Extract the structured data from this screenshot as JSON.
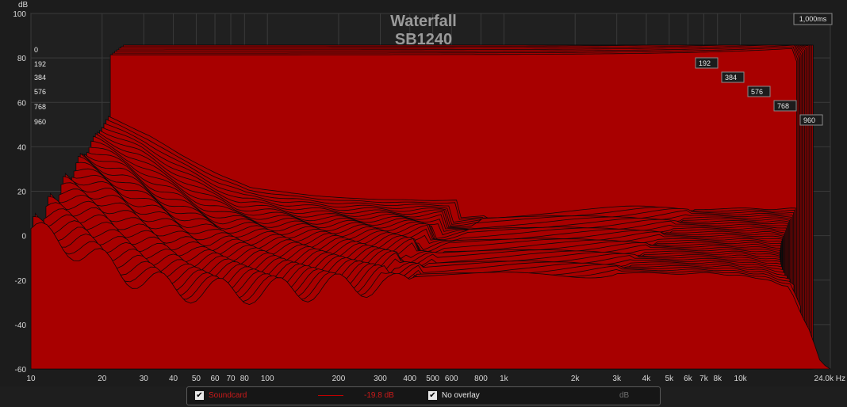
{
  "chart_data": {
    "type": "area",
    "title": "Waterfall",
    "subtitle": "SB1240",
    "ylabel": "dB",
    "xunit": "Hz",
    "x_scale": "log",
    "xlim": [
      10,
      24000
    ],
    "ylim": [
      -60,
      100
    ],
    "y_ticks": [
      "100",
      "80",
      "60",
      "40",
      "20",
      "0",
      "-20",
      "-40",
      "-60"
    ],
    "x_ticks": [
      "10",
      "20",
      "30",
      "40",
      "50",
      "60",
      "70",
      "80",
      "100",
      "200",
      "300",
      "400",
      "500",
      "600",
      "800",
      "1k",
      "2k",
      "3k",
      "4k",
      "5k",
      "6k",
      "7k",
      "8k",
      "10k",
      "24.0k Hz"
    ],
    "x_tick_values": [
      10,
      20,
      30,
      40,
      50,
      60,
      70,
      80,
      100,
      200,
      300,
      400,
      500,
      600,
      800,
      1000,
      2000,
      3000,
      4000,
      5000,
      6000,
      7000,
      8000,
      10000,
      24000
    ],
    "time_axis_max": "1,000ms",
    "time_slice_labels": [
      "0",
      "192",
      "384",
      "576",
      "768",
      "960"
    ],
    "series_color": "#cc0000",
    "front_slice_points": [
      [
        10,
        2
      ],
      [
        15,
        -5
      ],
      [
        20,
        -12
      ],
      [
        30,
        -20
      ],
      [
        40,
        -24
      ],
      [
        60,
        -25
      ],
      [
        100,
        -25
      ],
      [
        200,
        -23
      ],
      [
        400,
        -20
      ],
      [
        1000,
        -18
      ],
      [
        3000,
        -17
      ],
      [
        8000,
        -17
      ],
      [
        12000,
        -19
      ],
      [
        16000,
        -23
      ],
      [
        20000,
        -45
      ],
      [
        22000,
        -58
      ],
      [
        24000,
        -60
      ]
    ],
    "back_slice_level_db": 83,
    "back_slice_cutoff_hz": 7000
  },
  "legend": {
    "measurement_name": "Soundcard",
    "measurement_level": "-19.8 dB",
    "overlay_label": "No overlay",
    "overlay_unit": "dB"
  }
}
